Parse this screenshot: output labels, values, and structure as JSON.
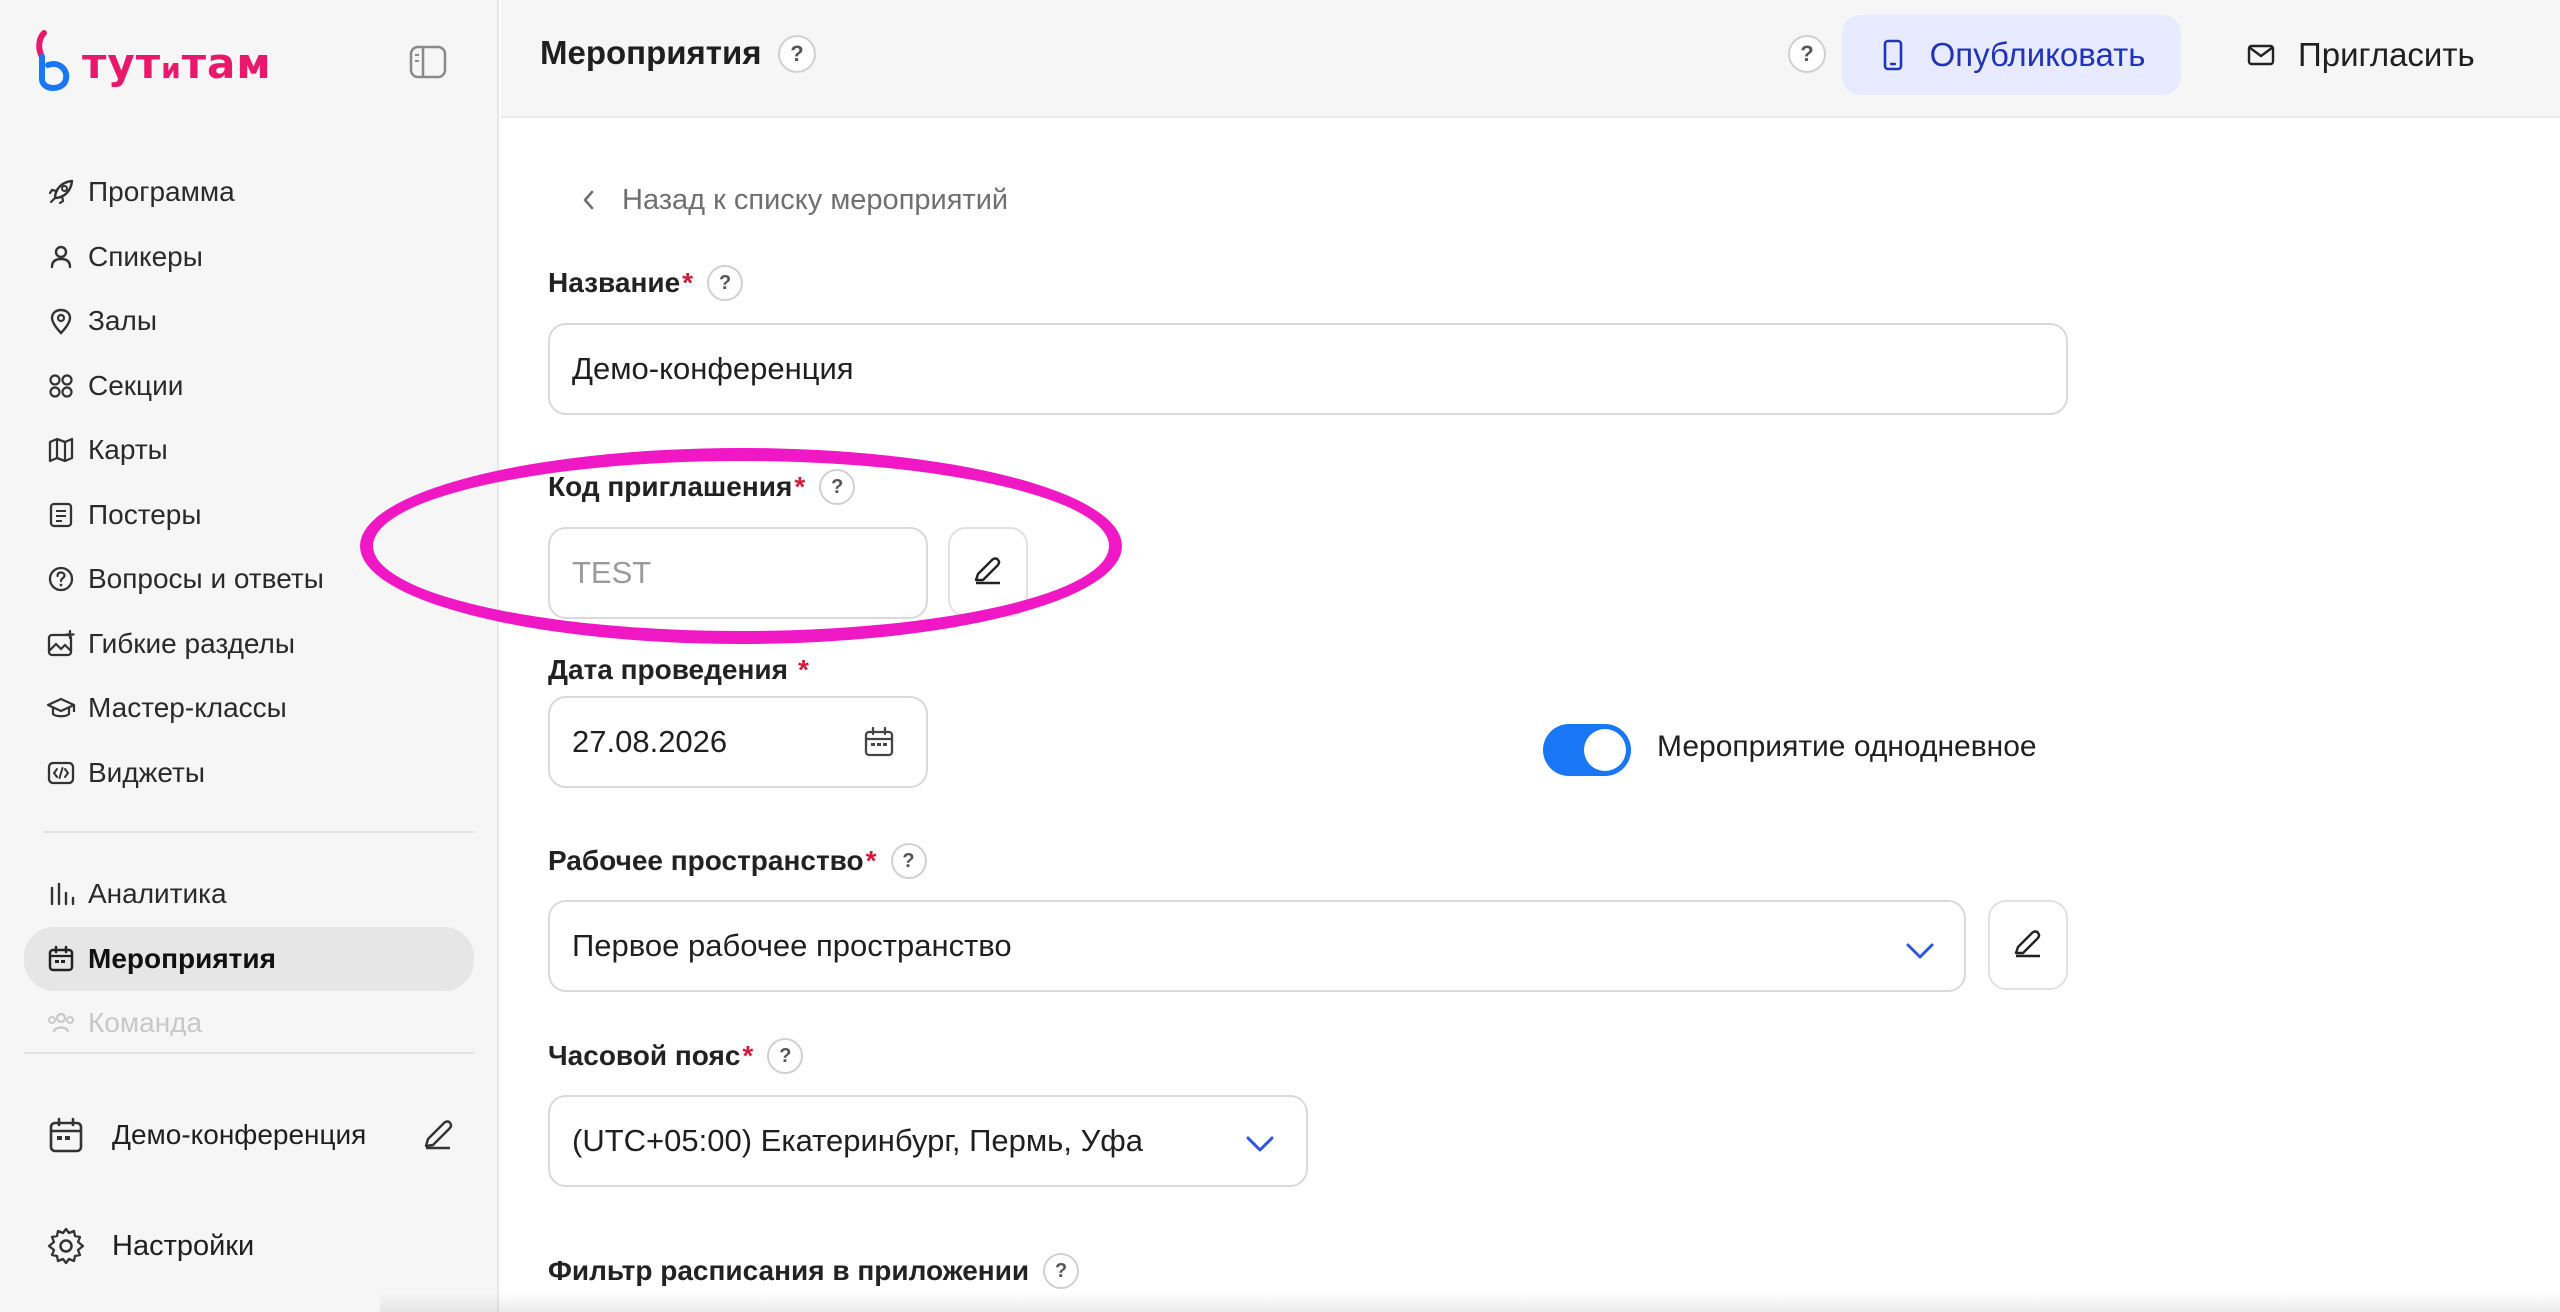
{
  "brand": {
    "logo_text_1": "тут",
    "logo_text_2": "и",
    "logo_text_3": "там"
  },
  "colors": {
    "brand": "#e8196b",
    "accent_blue": "#1976f5",
    "publish_bg": "#e8ebff",
    "publish_text": "#2133b8",
    "highlight": "#f017c5",
    "required": "#d6193b"
  },
  "sidebar": {
    "items": [
      {
        "label": "Программа",
        "icon": "rocket-icon"
      },
      {
        "label": "Спикеры",
        "icon": "user-icon"
      },
      {
        "label": "Залы",
        "icon": "map-pin-icon"
      },
      {
        "label": "Секции",
        "icon": "grid-circles-icon"
      },
      {
        "label": "Карты",
        "icon": "map-icon"
      },
      {
        "label": "Постеры",
        "icon": "poster-icon"
      },
      {
        "label": "Вопросы и ответы",
        "icon": "question-circle-icon"
      },
      {
        "label": "Гибкие разделы",
        "icon": "image-plus-icon"
      },
      {
        "label": "Мастер-классы",
        "icon": "graduation-cap-icon"
      },
      {
        "label": "Виджеты",
        "icon": "code-icon"
      }
    ],
    "items2": [
      {
        "label": "Аналитика",
        "icon": "bar-chart-icon"
      },
      {
        "label": "Мероприятия",
        "icon": "calendar-icon",
        "active": true
      },
      {
        "label": "Команда",
        "icon": "users-icon"
      }
    ],
    "current_event": "Демо-конференция",
    "settings_label": "Настройки"
  },
  "header": {
    "title": "Мероприятия",
    "help": "?",
    "publish_label": "Опубликовать",
    "invite_label": "Пригласить"
  },
  "form": {
    "back_label": "Назад к списку мероприятий",
    "name_label": "Название",
    "name_value": "Демо-конференция",
    "invite_code_label": "Код приглашения",
    "invite_code_value": "TEST",
    "date_label": "Дата проведения",
    "date_value": "27.08.2026",
    "one_day_label": "Мероприятие однодневное",
    "one_day_on": true,
    "workspace_label": "Рабочее пространство",
    "workspace_value": "Первое рабочее пространство",
    "timezone_label": "Часовой пояс",
    "timezone_value": "(UTC+05:00) Екатеринбург, Пермь, Уфа",
    "schedule_filter_label": "Фильтр расписания в приложении",
    "required_mark": "*"
  }
}
